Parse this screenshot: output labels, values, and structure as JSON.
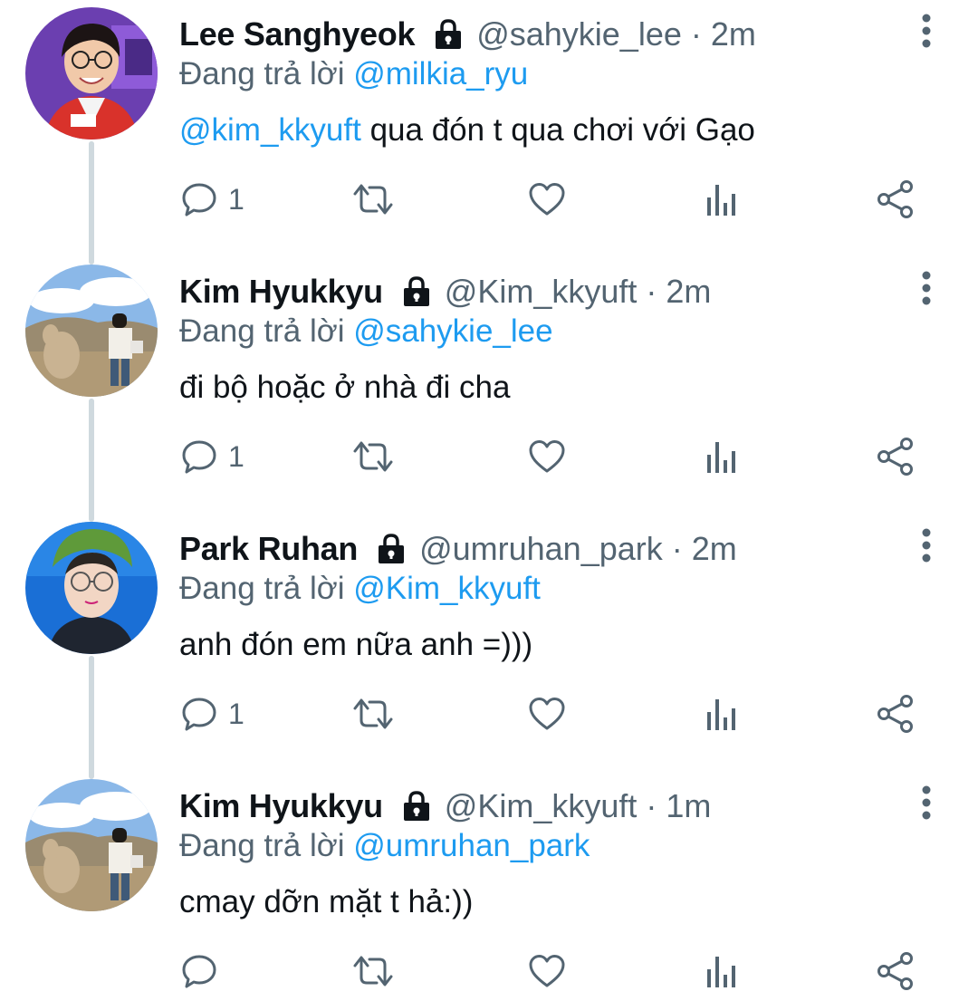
{
  "tweets": [
    {
      "name": "Lee Sanghyeok",
      "handle": "@sahykie_lee",
      "separator": "·",
      "time": "2m",
      "reply_prefix": "Đang trả lời",
      "reply_to": "@milkia_ryu",
      "mention": "@kim_kkyuft",
      "text": " qua đón t qua chơi với Gạo",
      "reply_count": "1",
      "avatar": "avatar-lee-sanghyeok"
    },
    {
      "name": "Kim Hyukkyu",
      "handle": "@Kim_kkyuft",
      "separator": "·",
      "time": "2m",
      "reply_prefix": "Đang trả lời",
      "reply_to": "@sahykie_lee",
      "mention": "",
      "text": "đi bộ hoặc ở nhà đi cha",
      "reply_count": "1",
      "avatar": "avatar-kim-hyukkyu"
    },
    {
      "name": "Park Ruhan",
      "handle": "@umruhan_park",
      "separator": "·",
      "time": "2m",
      "reply_prefix": "Đang trả lời",
      "reply_to": "@Kim_kkyuft",
      "mention": "",
      "text": "anh đón em nữa anh =)))",
      "reply_count": "1",
      "avatar": "avatar-park-ruhan"
    },
    {
      "name": "Kim Hyukkyu",
      "handle": "@Kim_kkyuft",
      "separator": "·",
      "time": "1m",
      "reply_prefix": "Đang trả lời",
      "reply_to": "@umruhan_park",
      "mention": "",
      "text": "cmay dỡn mặt t hả:))",
      "reply_count": "",
      "avatar": "avatar-kim-hyukkyu"
    }
  ],
  "icons": {
    "lock": "lock-icon",
    "more": "more-vertical-icon",
    "reply": "reply-bubble-icon",
    "retweet": "retweet-icon",
    "like": "heart-icon",
    "views": "analytics-icon",
    "share": "share-icon"
  },
  "colors": {
    "mention": "#1d9bf0",
    "secondary_text": "#536471",
    "primary_text": "#0f1419",
    "thread_line": "#cfd9de"
  }
}
